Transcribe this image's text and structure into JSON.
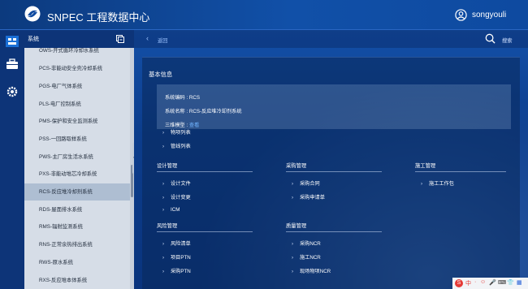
{
  "header": {
    "app_title": "SNPEC 工程数据中心",
    "username": "songyouli"
  },
  "rail": {
    "items": [
      "org-chart-icon",
      "briefcase-icon",
      "settings-gear-icon"
    ]
  },
  "sidebar": {
    "title": "系统",
    "items": [
      "OWS-开式循环冷却水系统",
      "PCS-非能动安全壳冷却系统",
      "PGS-电厂气体系统",
      "PLS-电厂控制系统",
      "PMS-保护和安全监测系统",
      "PSS-一回路取样系统",
      "PWS-主厂房生活水系统",
      "PXS-非能动堆芯冷却系统",
      "RCS-反应堆冷却剂系统",
      "RDS-屋面排水系统",
      "RMS-辐射监测系统",
      "RNS-正常余热排出系统",
      "RWS-原水系统",
      "RXS-反应堆本体系统"
    ],
    "active_index": 8
  },
  "main": {
    "back_label": "返回",
    "search_label": "搜索",
    "panel_title": "基本信息",
    "system_code": "系统编码 : RCS",
    "system_name": "系统名称 : RCS-反应堆冷却剂系统",
    "model_label": "三维模型 : ",
    "model_link": "查看",
    "top_entries": [
      "物项列表",
      "管线列表"
    ],
    "design": {
      "title": "设计管理",
      "items": [
        "设计文件",
        "设计变更",
        "ICM"
      ]
    },
    "procurement": {
      "title": "采购管理",
      "items": [
        "采购合同",
        "采购申请单"
      ]
    },
    "construction": {
      "title": "施工管理",
      "items": [
        "施工工作包"
      ]
    },
    "risk": {
      "title": "风险管理",
      "items": [
        "风险清单",
        "项目PTN",
        "采购PTN"
      ]
    },
    "quality": {
      "title": "质量管理",
      "items": [
        "采购NCR",
        "施工NCR",
        "现场物项NCR"
      ]
    }
  },
  "tray": {
    "items": [
      "S",
      "中",
      "·",
      "☺",
      "🎤",
      "⌨",
      "👕",
      "▦"
    ]
  }
}
